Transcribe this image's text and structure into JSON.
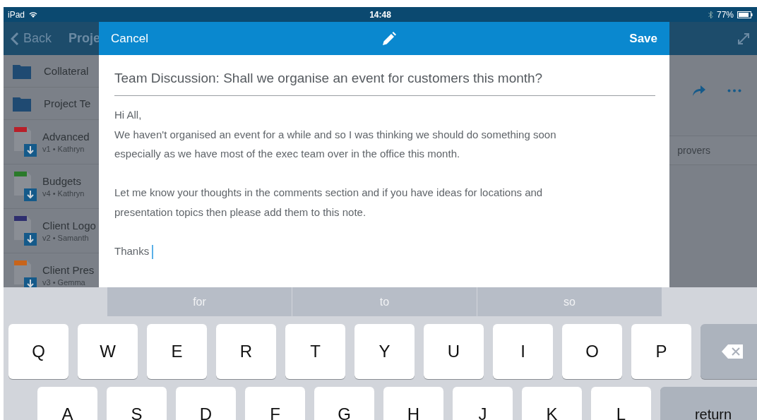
{
  "status_bar": {
    "carrier": "iPad",
    "time": "14:48",
    "battery": "77%"
  },
  "nav_bar": {
    "back": "Back",
    "title": "Proje"
  },
  "file_list": [
    {
      "kind": "folder",
      "name": "Collateral"
    },
    {
      "kind": "folder",
      "name": "Project Te"
    },
    {
      "kind": "file",
      "name": "Advanced",
      "meta": "v1 • Kathryn",
      "color": "#b8202a"
    },
    {
      "kind": "file",
      "name": "Budgets",
      "meta": "v4 • Kathryn",
      "color": "#2a7a2a"
    },
    {
      "kind": "file",
      "name": "Client Logo",
      "meta": "v2 • Samanth",
      "color": "#2e2e6e"
    },
    {
      "kind": "file",
      "name": "Client Pres",
      "meta": "v3 • Gemma",
      "color": "#c8641a"
    }
  ],
  "detail": {
    "tab": "provers"
  },
  "editor": {
    "cancel": "Cancel",
    "save": "Save",
    "title": "Team Discussion: Shall we organise an event for customers this month?",
    "body": "Hi All,\nWe haven't organised an event for a while and so I was thinking we should do something soon\nespecially as we have most of the exec team over in the office this month.\n\nLet me know your thoughts in the comments section and if you have ideas for locations and\npresentation topics then please add them to this note.\n\nThanks "
  },
  "keyboard": {
    "suggestions": [
      "for",
      "to",
      "so"
    ],
    "rows": [
      [
        {
          "kind": "letter",
          "label": "Q"
        },
        {
          "kind": "letter",
          "label": "W"
        },
        {
          "kind": "letter",
          "label": "E"
        },
        {
          "kind": "letter",
          "label": "R"
        },
        {
          "kind": "letter",
          "label": "T"
        },
        {
          "kind": "letter",
          "label": "Y"
        },
        {
          "kind": "letter",
          "label": "U"
        },
        {
          "kind": "letter",
          "label": "I"
        },
        {
          "kind": "letter",
          "label": "O"
        },
        {
          "kind": "letter",
          "label": "P"
        },
        {
          "kind": "delete"
        }
      ],
      [
        {
          "kind": "letter",
          "label": "A"
        },
        {
          "kind": "letter",
          "label": "S"
        },
        {
          "kind": "letter",
          "label": "D"
        },
        {
          "kind": "letter",
          "label": "F"
        },
        {
          "kind": "letter",
          "label": "G"
        },
        {
          "kind": "letter",
          "label": "H"
        },
        {
          "kind": "letter",
          "label": "J"
        },
        {
          "kind": "letter",
          "label": "K"
        },
        {
          "kind": "letter",
          "label": "L"
        },
        {
          "kind": "return",
          "label": "return"
        }
      ]
    ]
  }
}
